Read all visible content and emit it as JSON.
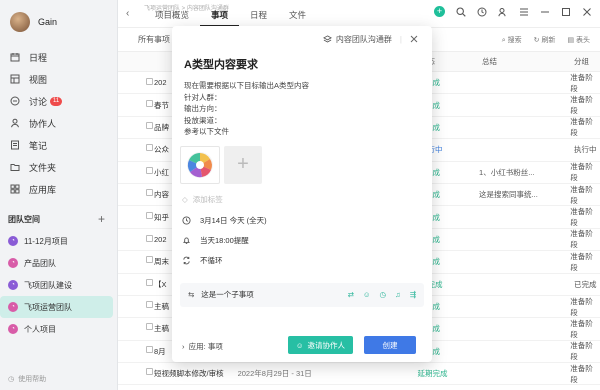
{
  "user": {
    "name": "Gain"
  },
  "nav": [
    {
      "label": "日程",
      "icon": "calendar-icon"
    },
    {
      "label": "视图",
      "icon": "view-icon"
    },
    {
      "label": "讨论",
      "icon": "discussion-icon",
      "badge": "11"
    },
    {
      "label": "协作人",
      "icon": "person-icon"
    },
    {
      "label": "笔记",
      "icon": "note-icon"
    },
    {
      "label": "文件夹",
      "icon": "folder-icon"
    },
    {
      "label": "应用库",
      "icon": "apps-icon"
    }
  ],
  "team_section": {
    "title": "团队空间",
    "add": "+"
  },
  "teams": [
    {
      "label": "11-12月项目",
      "color": "#8a5cd6"
    },
    {
      "label": "产品团队",
      "color": "#d85ca8"
    },
    {
      "label": "飞项团队建设",
      "color": "#8a5cd6"
    },
    {
      "label": "飞项运营团队",
      "color": "#d85ca8",
      "active": true
    },
    {
      "label": "个人项目",
      "color": "#d85ca8"
    }
  ],
  "help": "使用帮助",
  "breadcrumb": "飞项运营团队 > 内容团队沟通群",
  "tabs": [
    "项目概览",
    "事项",
    "日程",
    "文件"
  ],
  "active_tab": 1,
  "toolbar": {
    "left": "所有事项",
    "search": "搜索",
    "refresh": "刷新",
    "header": "表头"
  },
  "columns": {
    "status": "状态",
    "summary": "总结",
    "stage": "分组"
  },
  "rows": [
    {
      "title": "202",
      "status": "已完成",
      "summary": "",
      "stage": "准备阶段"
    },
    {
      "title": "春节",
      "status": "已完成",
      "summary": "",
      "stage": "准备阶段"
    },
    {
      "title": "品牌",
      "status": "已完成",
      "summary": "",
      "stage": "准备阶段"
    },
    {
      "title": "公众",
      "status": "进行中",
      "summary": "",
      "stage": "执行中"
    },
    {
      "title": "小红",
      "status": "已完成",
      "summary": "1、小红书粉丝...",
      "stage": "准备阶段"
    },
    {
      "title": "内容",
      "status": "已完成",
      "summary": "这是搜索同事统...",
      "stage": "准备阶段"
    },
    {
      "title": "知乎",
      "status": "已完成",
      "summary": "",
      "stage": "准备阶段"
    },
    {
      "title": "202",
      "status": "已完成",
      "summary": "",
      "stage": "准备阶段"
    },
    {
      "title": "周末",
      "status": "已完成",
      "summary": "",
      "stage": "准备阶段"
    },
    {
      "title": "【X",
      "status": "已完成",
      "summary": "",
      "stage": "已完成"
    },
    {
      "title": "主稿",
      "status": "已完成",
      "summary": "",
      "stage": "准备阶段"
    },
    {
      "title": "主稿",
      "status": "已完成",
      "summary": "",
      "stage": "准备阶段"
    },
    {
      "title": "8月",
      "status": "已完成",
      "summary": "",
      "stage": "准备阶段"
    },
    {
      "title": "短视频脚本修改/审核",
      "date": "2022年8月29日 - 31日",
      "status": "延期完成",
      "summary": "",
      "stage": "准备阶段"
    }
  ],
  "modal": {
    "group": "内容团队沟通群",
    "title": "A类型内容要求",
    "desc": [
      "现在需要根据以下目标输出A类型内容",
      "针对人群：",
      "输出方向：",
      "投放渠道：",
      "参考以下文件"
    ],
    "add_tag": "添加标签",
    "date": "3月14日 今天 (全天)",
    "reminder": "当天18:00提醒",
    "repeat": "不循环",
    "subtask": "这是一个子事项",
    "app_label": "应用: 事项",
    "invite": "邀请协作人",
    "create": "创建"
  }
}
